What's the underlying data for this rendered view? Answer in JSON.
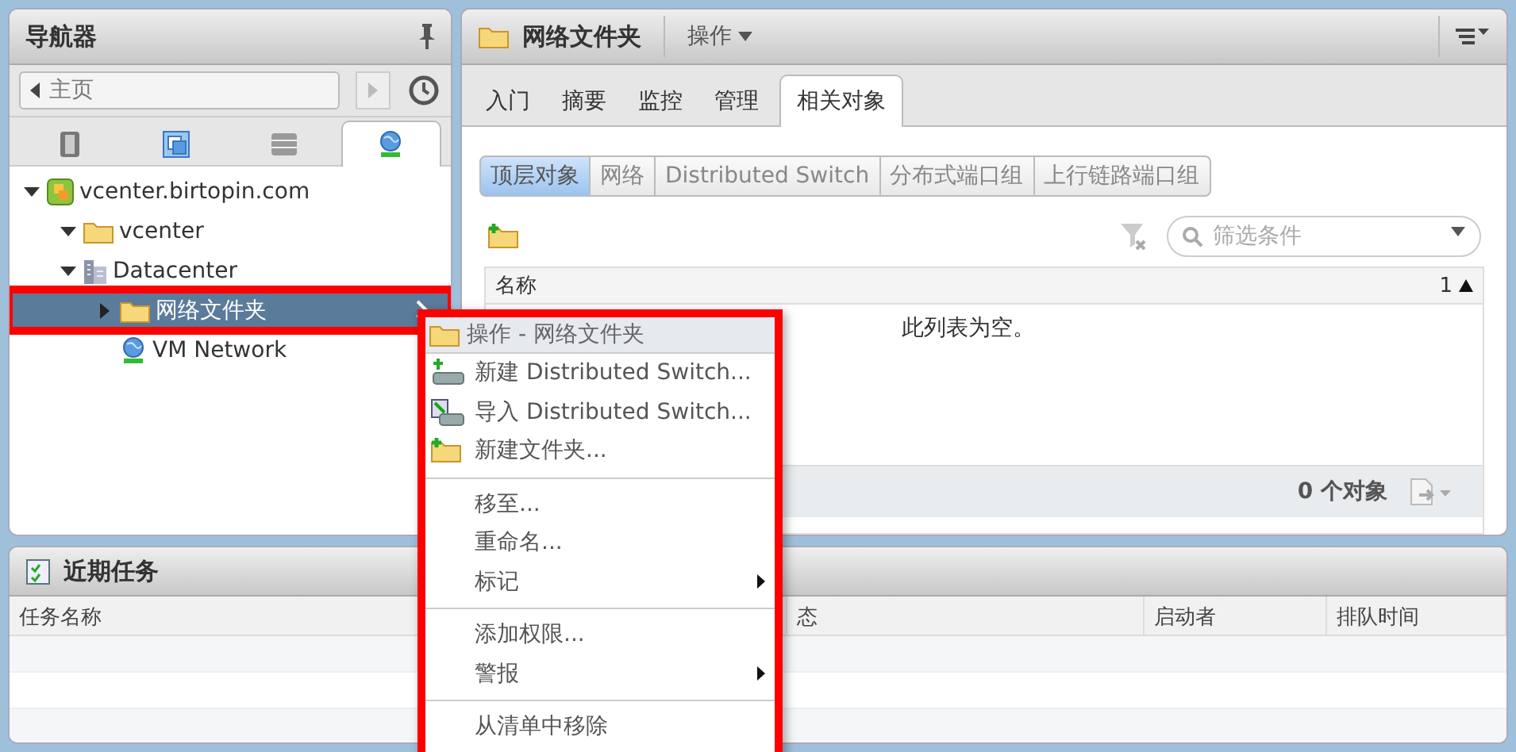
{
  "navigator": {
    "title": "导航器",
    "breadcrumb": "主页",
    "tabs": [
      {
        "kind": "hosts",
        "selected": false
      },
      {
        "kind": "vms",
        "selected": false
      },
      {
        "kind": "storage",
        "selected": false
      },
      {
        "kind": "networking",
        "selected": true
      }
    ],
    "tree": [
      {
        "label": "vcenter.birtopin.com",
        "kind": "vcenter",
        "expanded": true,
        "selected": false,
        "children": [
          {
            "label": "vcenter",
            "kind": "folder",
            "expanded": true,
            "selected": false
          },
          {
            "label": "Datacenter",
            "kind": "datacenter",
            "expanded": true,
            "selected": false,
            "children": [
              {
                "label": "网络文件夹",
                "kind": "folder",
                "expanded": false,
                "selected": true,
                "highlighted": true
              },
              {
                "label": "VM Network",
                "kind": "network",
                "selected": false
              }
            ]
          }
        ]
      }
    ]
  },
  "object_panel": {
    "title": "网络文件夹",
    "actions_label": "操作",
    "tabs": [
      {
        "label": "入门",
        "selected": false
      },
      {
        "label": "摘要",
        "selected": false
      },
      {
        "label": "监控",
        "selected": false
      },
      {
        "label": "管理",
        "selected": false
      },
      {
        "label": "相关对象",
        "selected": true
      }
    ],
    "segments": [
      {
        "label": "顶层对象",
        "selected": true
      },
      {
        "label": "网络",
        "selected": false
      },
      {
        "label": "Distributed Switch",
        "selected": false
      },
      {
        "label": "分布式端口组",
        "selected": false
      },
      {
        "label": "上行链路端口组",
        "selected": false
      }
    ],
    "filter": {
      "placeholder": "筛选条件"
    },
    "table": {
      "columns": [
        "名称"
      ],
      "sort_index": "1",
      "empty_message": "此列表为空。"
    },
    "footer": {
      "count": "0 个对象"
    }
  },
  "recent_tasks": {
    "title": "近期任务",
    "columns": [
      "任务名称",
      "态",
      "启动者",
      "排队时间"
    ]
  },
  "context_menu": {
    "highlighted": true,
    "title": "操作 - 网络文件夹",
    "items": [
      {
        "kind": "new-switch",
        "label": "新建 Distributed Switch...",
        "submenu": false
      },
      {
        "kind": "import-switch",
        "label": "导入 Distributed Switch...",
        "submenu": false
      },
      {
        "kind": "new-folder",
        "label": "新建文件夹...",
        "submenu": false
      },
      {
        "kind": "separator"
      },
      {
        "kind": "item",
        "label": "移至...",
        "submenu": false
      },
      {
        "kind": "item",
        "label": "重命名...",
        "submenu": false
      },
      {
        "kind": "item",
        "label": "标记",
        "submenu": true
      },
      {
        "kind": "separator"
      },
      {
        "kind": "item",
        "label": "添加权限...",
        "submenu": false
      },
      {
        "kind": "item",
        "label": "警报",
        "submenu": true
      },
      {
        "kind": "separator"
      },
      {
        "kind": "item",
        "label": "从清单中移除",
        "submenu": false
      }
    ]
  }
}
